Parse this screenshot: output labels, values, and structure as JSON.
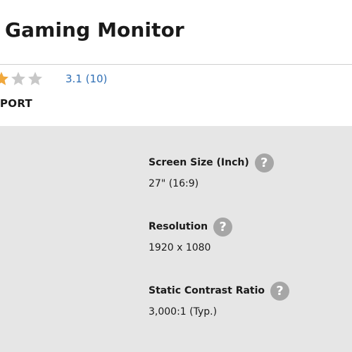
{
  "product": {
    "title": "Gaming Monitor"
  },
  "rating": {
    "value": 3.1,
    "text": "3.1 (10)",
    "colors": {
      "filled": "#f0a83c",
      "empty": "#c8c8c8"
    }
  },
  "support": {
    "label": "PORT"
  },
  "specs": [
    {
      "label": "Screen Size (Inch)",
      "help_icon": "?",
      "value": "27\" (16:9)"
    },
    {
      "label": "Resolution",
      "help_icon": "?",
      "value": "1920 x 1080"
    },
    {
      "label": "Static Contrast Ratio",
      "help_icon": "?",
      "value": "3,000:1 (Typ.)"
    }
  ],
  "colors": {
    "link": "#2f6fb5",
    "spec_background": "#e6e6e6",
    "help_icon_bg": "#a6a6a6"
  }
}
